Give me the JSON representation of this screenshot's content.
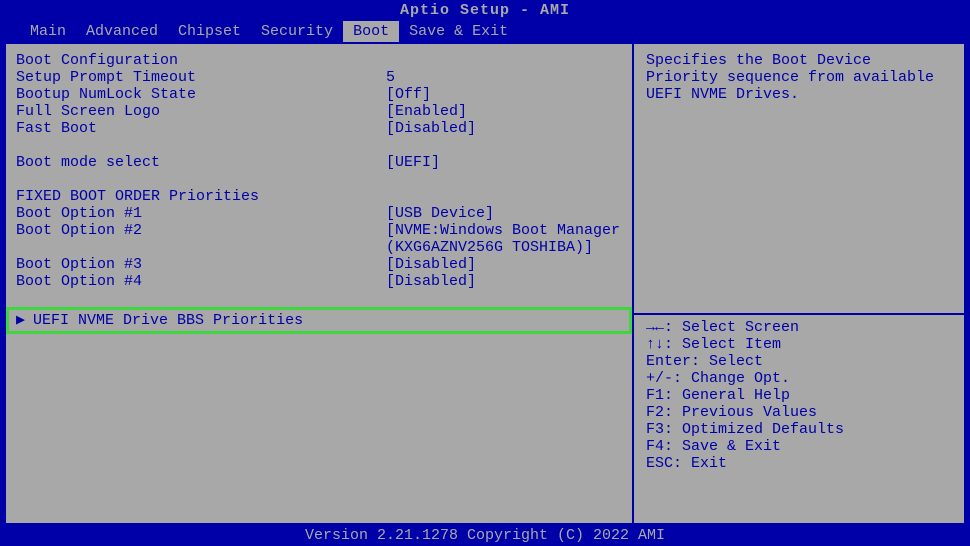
{
  "title": "Aptio Setup - AMI",
  "menu": {
    "items": [
      "Main",
      "Advanced",
      "Chipset",
      "Security",
      "Boot",
      "Save & Exit"
    ],
    "active": "Boot"
  },
  "sections": {
    "boot_config": {
      "header": "Boot Configuration",
      "items": [
        {
          "label": "Setup Prompt Timeout",
          "value": "5"
        },
        {
          "label": "Bootup NumLock State",
          "value": "[Off]"
        },
        {
          "label": "Full Screen Logo",
          "value": "[Enabled]"
        },
        {
          "label": "Fast Boot",
          "value": "[Disabled]"
        }
      ]
    },
    "boot_mode": {
      "label": "Boot mode select",
      "value": "[UEFI]"
    },
    "boot_order": {
      "header": "FIXED BOOT ORDER Priorities",
      "items": [
        {
          "label": "Boot Option #1",
          "value": "[USB Device]"
        },
        {
          "label": "Boot Option #2",
          "value": "[NVME:Windows Boot Manager (KXG6AZNV256G TOSHIBA)]"
        },
        {
          "label": "Boot Option #3",
          "value": "[Disabled]"
        },
        {
          "label": "Boot Option #4",
          "value": "[Disabled]"
        }
      ]
    },
    "submenu": {
      "arrow": "▶",
      "label": "UEFI NVME Drive BBS Priorities"
    }
  },
  "help": {
    "description": "Specifies the Boot Device Priority sequence from available UEFI NVME Drives.",
    "keys": [
      "→←: Select Screen",
      "↑↓: Select Item",
      "Enter: Select",
      "+/-: Change Opt.",
      "F1: General Help",
      "F2: Previous Values",
      "F3: Optimized Defaults",
      "F4: Save & Exit",
      "ESC: Exit"
    ]
  },
  "footer": "Version 2.21.1278 Copyright (C) 2022 AMI"
}
